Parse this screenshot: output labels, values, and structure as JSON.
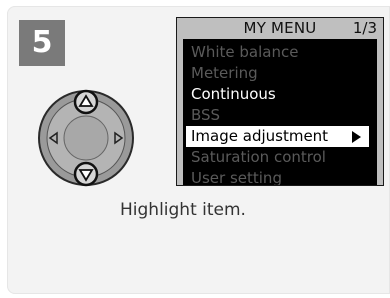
{
  "step_number": "5",
  "menu": {
    "title": "MY MENU",
    "page": "1/3",
    "items": [
      {
        "label": "White balance",
        "state": "disabled"
      },
      {
        "label": "Metering",
        "state": "disabled"
      },
      {
        "label": "Continuous",
        "state": "enabled"
      },
      {
        "label": "BSS",
        "state": "disabled"
      },
      {
        "label": "Image adjustment",
        "state": "selected"
      },
      {
        "label": "Saturation control",
        "state": "disabled"
      },
      {
        "label": "User setting",
        "state": "disabled"
      }
    ]
  },
  "caption": "Highlight item.",
  "dpad": {
    "highlighted_buttons": [
      "up",
      "down"
    ]
  }
}
